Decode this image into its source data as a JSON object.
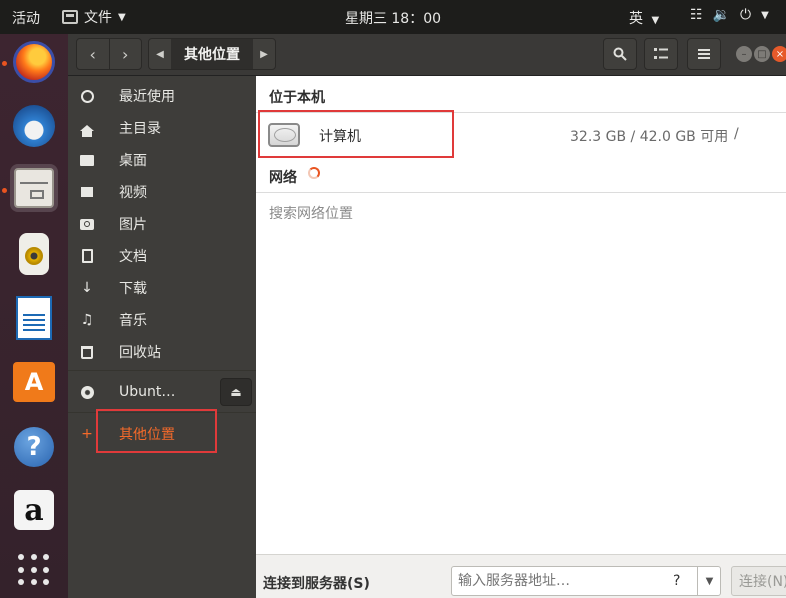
{
  "topbar": {
    "activities": "活动",
    "app_menu_label": "文件",
    "clock": "星期三 18：00",
    "input_method": "英",
    "tray_icons": [
      "network-icon",
      "volume-icon",
      "power-icon"
    ]
  },
  "dock": {
    "apps": [
      "firefox-icon",
      "thunderbird-icon",
      "files-icon",
      "rhythmbox-icon",
      "libreoffice-writer-icon",
      "software-center-icon",
      "help-icon",
      "amazon-icon",
      "show-apps-icon"
    ],
    "active_app": "files-icon"
  },
  "headerbar": {
    "path_crumb": "其他位置"
  },
  "sidebar": {
    "items": [
      {
        "label": "最近使用",
        "icon": "clock-icon"
      },
      {
        "label": "主目录",
        "icon": "home-icon"
      },
      {
        "label": "桌面",
        "icon": "folder-icon"
      },
      {
        "label": "视频",
        "icon": "video-icon"
      },
      {
        "label": "图片",
        "icon": "camera-icon"
      },
      {
        "label": "文档",
        "icon": "document-icon"
      },
      {
        "label": "下载",
        "icon": "download-icon"
      },
      {
        "label": "音乐",
        "icon": "music-icon"
      },
      {
        "label": "回收站",
        "icon": "trash-icon"
      }
    ],
    "device": {
      "label": "Ubunt…",
      "icon": "disc-icon"
    },
    "other_locations": {
      "label": "其他位置",
      "icon": "plus-icon"
    }
  },
  "main": {
    "on_this_computer": "位于本机",
    "computer": {
      "name": "计算机",
      "size": "32.3 GB / 42.0 GB 可用",
      "mount": "/"
    },
    "network_title": "网络",
    "network_search": "搜索网络位置"
  },
  "bottombar": {
    "connect_label": "连接到服务器(S)",
    "server_placeholder": "输入服务器地址…",
    "help_glyph": "?",
    "connect_button": "连接(N)"
  },
  "colors": {
    "accent": "#e95420",
    "highlight_box": "#e03a3a"
  }
}
